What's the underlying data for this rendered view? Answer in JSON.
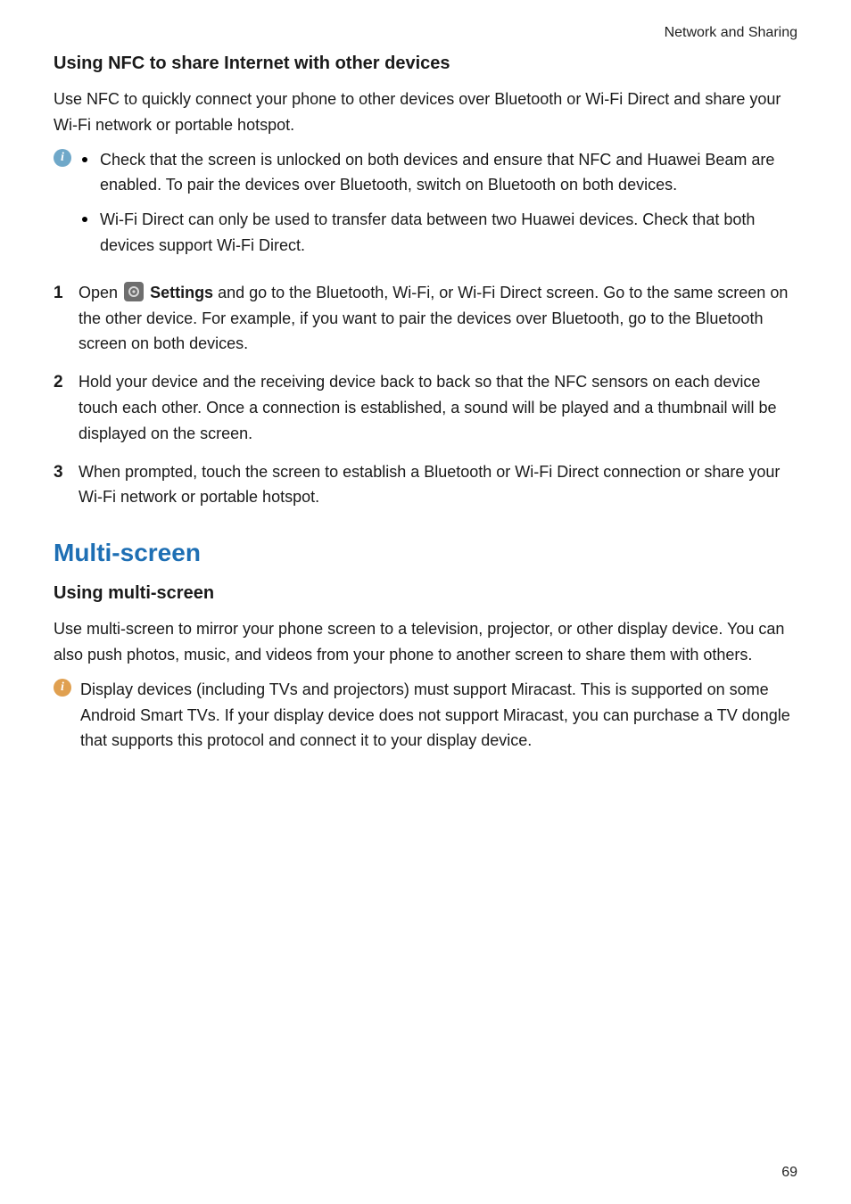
{
  "header": {
    "section": "Network and Sharing"
  },
  "sec1": {
    "title": "Using NFC to share Internet with other devices",
    "intro": "Use NFC to quickly connect your phone to other devices over Bluetooth or Wi-Fi Direct and share your Wi-Fi network or portable hotspot.",
    "note_bullets": [
      "Check that the screen is unlocked on both devices and ensure that NFC and Huawei Beam are enabled. To pair the devices over Bluetooth, switch on Bluetooth on both devices.",
      "Wi-Fi Direct can only be used to transfer data between two Huawei devices. Check that both devices support Wi-Fi Direct."
    ],
    "steps": {
      "n1": "1",
      "s1_a": "Open ",
      "s1_settings": "Settings",
      "s1_b": " and go to the Bluetooth, Wi-Fi, or Wi-Fi Direct screen. Go to the same screen on the other device. For example, if you want to pair the devices over Bluetooth, go to the Bluetooth screen on both devices.",
      "n2": "2",
      "s2": "Hold your device and the receiving device back to back so that the NFC sensors on each device touch each other. Once a connection is established, a sound will be played and a thumbnail will be displayed on the screen.",
      "n3": "3",
      "s3": "When prompted, touch the screen to establish a Bluetooth or Wi-Fi Direct connection or share your Wi-Fi network or portable hotspot."
    }
  },
  "sec2": {
    "heading": "Multi-screen",
    "subheading": "Using multi-screen",
    "intro": "Use multi-screen to mirror your phone screen to a television, projector, or other display device. You can also push photos, music, and videos from your phone to another screen to share them with others.",
    "note": "Display devices (including TVs and projectors) must support Miracast. This is supported on some Android Smart TVs. If your display device does not support Miracast, you can purchase a TV dongle that supports this protocol and connect it to your display device."
  },
  "page_number": "69"
}
